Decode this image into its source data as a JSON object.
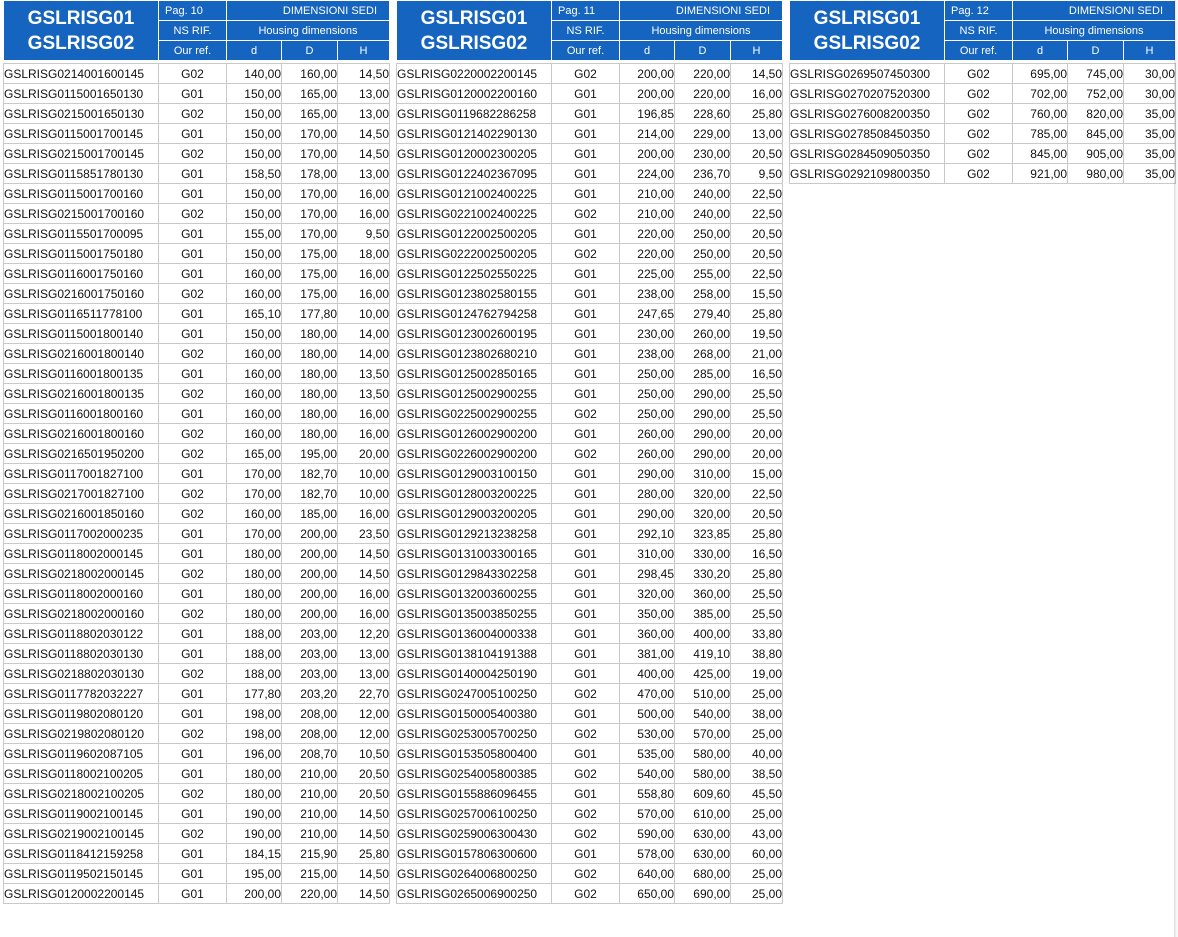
{
  "panels": [
    {
      "title_line1": "GSLRISG01",
      "title_line2": "GSLRISG02",
      "page_label": "Pag. 10",
      "section_label": "DIMENSIONI SEDI",
      "ns_rif": "NS RIF.",
      "housing_label": "Housing dimensions",
      "our_ref": "Our ref.",
      "col_d": "d",
      "col_D": "D",
      "col_H": "H",
      "rows": [
        [
          "GSLRISG0214001600145",
          "G02",
          "140,00",
          "160,00",
          "14,50"
        ],
        [
          "GSLRISG0115001650130",
          "G01",
          "150,00",
          "165,00",
          "13,00"
        ],
        [
          "GSLRISG0215001650130",
          "G02",
          "150,00",
          "165,00",
          "13,00"
        ],
        [
          "GSLRISG0115001700145",
          "G01",
          "150,00",
          "170,00",
          "14,50"
        ],
        [
          "GSLRISG0215001700145",
          "G02",
          "150,00",
          "170,00",
          "14,50"
        ],
        [
          "GSLRISG0115851780130",
          "G01",
          "158,50",
          "178,00",
          "13,00"
        ],
        [
          "GSLRISG0115001700160",
          "G01",
          "150,00",
          "170,00",
          "16,00"
        ],
        [
          "GSLRISG0215001700160",
          "G02",
          "150,00",
          "170,00",
          "16,00"
        ],
        [
          "GSLRISG0115501700095",
          "G01",
          "155,00",
          "170,00",
          "9,50"
        ],
        [
          "GSLRISG0115001750180",
          "G01",
          "150,00",
          "175,00",
          "18,00"
        ],
        [
          "GSLRISG0116001750160",
          "G01",
          "160,00",
          "175,00",
          "16,00"
        ],
        [
          "GSLRISG0216001750160",
          "G02",
          "160,00",
          "175,00",
          "16,00"
        ],
        [
          "GSLRISG0116511778100",
          "G01",
          "165,10",
          "177,80",
          "10,00"
        ],
        [
          "GSLRISG0115001800140",
          "G01",
          "150,00",
          "180,00",
          "14,00"
        ],
        [
          "GSLRISG0216001800140",
          "G02",
          "160,00",
          "180,00",
          "14,00"
        ],
        [
          "GSLRISG0116001800135",
          "G01",
          "160,00",
          "180,00",
          "13,50"
        ],
        [
          "GSLRISG0216001800135",
          "G02",
          "160,00",
          "180,00",
          "13,50"
        ],
        [
          "GSLRISG0116001800160",
          "G01",
          "160,00",
          "180,00",
          "16,00"
        ],
        [
          "GSLRISG0216001800160",
          "G02",
          "160,00",
          "180,00",
          "16,00"
        ],
        [
          "GSLRISG0216501950200",
          "G02",
          "165,00",
          "195,00",
          "20,00"
        ],
        [
          "GSLRISG0117001827100",
          "G01",
          "170,00",
          "182,70",
          "10,00"
        ],
        [
          "GSLRISG0217001827100",
          "G02",
          "170,00",
          "182,70",
          "10,00"
        ],
        [
          "GSLRISG0216001850160",
          "G02",
          "160,00",
          "185,00",
          "16,00"
        ],
        [
          "GSLRISG0117002000235",
          "G01",
          "170,00",
          "200,00",
          "23,50"
        ],
        [
          "GSLRISG0118002000145",
          "G01",
          "180,00",
          "200,00",
          "14,50"
        ],
        [
          "GSLRISG0218002000145",
          "G02",
          "180,00",
          "200,00",
          "14,50"
        ],
        [
          "GSLRISG0118002000160",
          "G01",
          "180,00",
          "200,00",
          "16,00"
        ],
        [
          "GSLRISG0218002000160",
          "G02",
          "180,00",
          "200,00",
          "16,00"
        ],
        [
          "GSLRISG0118802030122",
          "G01",
          "188,00",
          "203,00",
          "12,20"
        ],
        [
          "GSLRISG0118802030130",
          "G01",
          "188,00",
          "203,00",
          "13,00"
        ],
        [
          "GSLRISG0218802030130",
          "G02",
          "188,00",
          "203,00",
          "13,00"
        ],
        [
          "GSLRISG0117782032227",
          "G01",
          "177,80",
          "203,20",
          "22,70"
        ],
        [
          "GSLRISG0119802080120",
          "G01",
          "198,00",
          "208,00",
          "12,00"
        ],
        [
          "GSLRISG0219802080120",
          "G02",
          "198,00",
          "208,00",
          "12,00"
        ],
        [
          "GSLRISG0119602087105",
          "G01",
          "196,00",
          "208,70",
          "10,50"
        ],
        [
          "GSLRISG0118002100205",
          "G01",
          "180,00",
          "210,00",
          "20,50"
        ],
        [
          "GSLRISG0218002100205",
          "G02",
          "180,00",
          "210,00",
          "20,50"
        ],
        [
          "GSLRISG0119002100145",
          "G01",
          "190,00",
          "210,00",
          "14,50"
        ],
        [
          "GSLRISG0219002100145",
          "G02",
          "190,00",
          "210,00",
          "14,50"
        ],
        [
          "GSLRISG0118412159258",
          "G01",
          "184,15",
          "215,90",
          "25,80"
        ],
        [
          "GSLRISG0119502150145",
          "G01",
          "195,00",
          "215,00",
          "14,50"
        ],
        [
          "GSLRISG0120002200145",
          "G01",
          "200,00",
          "220,00",
          "14,50"
        ]
      ]
    },
    {
      "title_line1": "GSLRISG01",
      "title_line2": "GSLRISG02",
      "page_label": "Pag. 11",
      "section_label": "DIMENSIONI SEDI",
      "ns_rif": "NS RIF.",
      "housing_label": "Housing dimensions",
      "our_ref": "Our ref.",
      "col_d": "d",
      "col_D": "D",
      "col_H": "H",
      "rows": [
        [
          "GSLRISG0220002200145",
          "G02",
          "200,00",
          "220,00",
          "14,50"
        ],
        [
          "GSLRISG0120002200160",
          "G01",
          "200,00",
          "220,00",
          "16,00"
        ],
        [
          "GSLRISG0119682286258",
          "G01",
          "196,85",
          "228,60",
          "25,80"
        ],
        [
          "GSLRISG0121402290130",
          "G01",
          "214,00",
          "229,00",
          "13,00"
        ],
        [
          "GSLRISG0120002300205",
          "G01",
          "200,00",
          "230,00",
          "20,50"
        ],
        [
          "GSLRISG0122402367095",
          "G01",
          "224,00",
          "236,70",
          "9,50"
        ],
        [
          "GSLRISG0121002400225",
          "G01",
          "210,00",
          "240,00",
          "22,50"
        ],
        [
          "GSLRISG0221002400225",
          "G02",
          "210,00",
          "240,00",
          "22,50"
        ],
        [
          "GSLRISG0122002500205",
          "G01",
          "220,00",
          "250,00",
          "20,50"
        ],
        [
          "GSLRISG0222002500205",
          "G02",
          "220,00",
          "250,00",
          "20,50"
        ],
        [
          "GSLRISG0122502550225",
          "G01",
          "225,00",
          "255,00",
          "22,50"
        ],
        [
          "GSLRISG0123802580155",
          "G01",
          "238,00",
          "258,00",
          "15,50"
        ],
        [
          "GSLRISG0124762794258",
          "G01",
          "247,65",
          "279,40",
          "25,80"
        ],
        [
          "GSLRISG0123002600195",
          "G01",
          "230,00",
          "260,00",
          "19,50"
        ],
        [
          "GSLRISG0123802680210",
          "G01",
          "238,00",
          "268,00",
          "21,00"
        ],
        [
          "GSLRISG0125002850165",
          "G01",
          "250,00",
          "285,00",
          "16,50"
        ],
        [
          "GSLRISG0125002900255",
          "G01",
          "250,00",
          "290,00",
          "25,50"
        ],
        [
          "GSLRISG0225002900255",
          "G02",
          "250,00",
          "290,00",
          "25,50"
        ],
        [
          "GSLRISG0126002900200",
          "G01",
          "260,00",
          "290,00",
          "20,00"
        ],
        [
          "GSLRISG0226002900200",
          "G02",
          "260,00",
          "290,00",
          "20,00"
        ],
        [
          "GSLRISG0129003100150",
          "G01",
          "290,00",
          "310,00",
          "15,00"
        ],
        [
          "GSLRISG0128003200225",
          "G01",
          "280,00",
          "320,00",
          "22,50"
        ],
        [
          "GSLRISG0129003200205",
          "G01",
          "290,00",
          "320,00",
          "20,50"
        ],
        [
          "GSLRISG0129213238258",
          "G01",
          "292,10",
          "323,85",
          "25,80"
        ],
        [
          "GSLRISG0131003300165",
          "G01",
          "310,00",
          "330,00",
          "16,50"
        ],
        [
          "GSLRISG0129843302258",
          "G01",
          "298,45",
          "330,20",
          "25,80"
        ],
        [
          "GSLRISG0132003600255",
          "G01",
          "320,00",
          "360,00",
          "25,50"
        ],
        [
          "GSLRISG0135003850255",
          "G01",
          "350,00",
          "385,00",
          "25,50"
        ],
        [
          "GSLRISG0136004000338",
          "G01",
          "360,00",
          "400,00",
          "33,80"
        ],
        [
          "GSLRISG0138104191388",
          "G01",
          "381,00",
          "419,10",
          "38,80"
        ],
        [
          "GSLRISG0140004250190",
          "G01",
          "400,00",
          "425,00",
          "19,00"
        ],
        [
          "GSLRISG0247005100250",
          "G02",
          "470,00",
          "510,00",
          "25,00"
        ],
        [
          "GSLRISG0150005400380",
          "G01",
          "500,00",
          "540,00",
          "38,00"
        ],
        [
          "GSLRISG0253005700250",
          "G02",
          "530,00",
          "570,00",
          "25,00"
        ],
        [
          "GSLRISG0153505800400",
          "G01",
          "535,00",
          "580,00",
          "40,00"
        ],
        [
          "GSLRISG0254005800385",
          "G02",
          "540,00",
          "580,00",
          "38,50"
        ],
        [
          "GSLRISG0155886096455",
          "G01",
          "558,80",
          "609,60",
          "45,50"
        ],
        [
          "GSLRISG0257006100250",
          "G02",
          "570,00",
          "610,00",
          "25,00"
        ],
        [
          "GSLRISG0259006300430",
          "G02",
          "590,00",
          "630,00",
          "43,00"
        ],
        [
          "GSLRISG0157806300600",
          "G01",
          "578,00",
          "630,00",
          "60,00"
        ],
        [
          "GSLRISG0264006800250",
          "G02",
          "640,00",
          "680,00",
          "25,00"
        ],
        [
          "GSLRISG0265006900250",
          "G02",
          "650,00",
          "690,00",
          "25,00"
        ]
      ]
    },
    {
      "title_line1": "GSLRISG01",
      "title_line2": "GSLRISG02",
      "page_label": "Pag. 12",
      "section_label": "DIMENSIONI SEDI",
      "ns_rif": "NS RIF.",
      "housing_label": "Housing dimensions",
      "our_ref": "Our ref.",
      "col_d": "d",
      "col_D": "D",
      "col_H": "H",
      "rows": [
        [
          "GSLRISG0269507450300",
          "G02",
          "695,00",
          "745,00",
          "30,00"
        ],
        [
          "GSLRISG0270207520300",
          "G02",
          "702,00",
          "752,00",
          "30,00"
        ],
        [
          "GSLRISG0276008200350",
          "G02",
          "760,00",
          "820,00",
          "35,00"
        ],
        [
          "GSLRISG0278508450350",
          "G02",
          "785,00",
          "845,00",
          "35,00"
        ],
        [
          "GSLRISG0284509050350",
          "G02",
          "845,00",
          "905,00",
          "35,00"
        ],
        [
          "GSLRISG0292109800350",
          "G02",
          "921,00",
          "980,00",
          "35,00"
        ]
      ]
    }
  ]
}
